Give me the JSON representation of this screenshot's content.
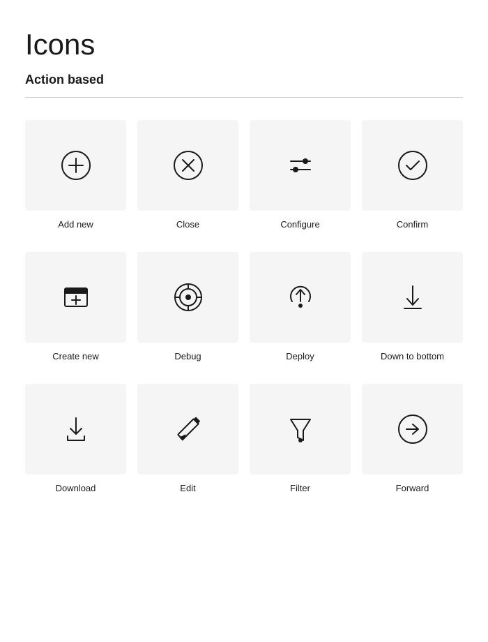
{
  "page": {
    "title": "Icons",
    "section": "Action based"
  },
  "rows": [
    {
      "icons": [
        {
          "name": "add-new-icon",
          "label": "Add new"
        },
        {
          "name": "close-icon",
          "label": "Close"
        },
        {
          "name": "configure-icon",
          "label": "Configure"
        },
        {
          "name": "confirm-icon",
          "label": "Confirm"
        }
      ]
    },
    {
      "icons": [
        {
          "name": "create-new-icon",
          "label": "Create new"
        },
        {
          "name": "debug-icon",
          "label": "Debug"
        },
        {
          "name": "deploy-icon",
          "label": "Deploy"
        },
        {
          "name": "down-to-bottom-icon",
          "label": "Down to bottom"
        }
      ]
    },
    {
      "icons": [
        {
          "name": "download-icon",
          "label": "Download"
        },
        {
          "name": "edit-icon",
          "label": "Edit"
        },
        {
          "name": "filter-icon",
          "label": "Filter"
        },
        {
          "name": "forward-icon",
          "label": "Forward"
        }
      ]
    }
  ]
}
